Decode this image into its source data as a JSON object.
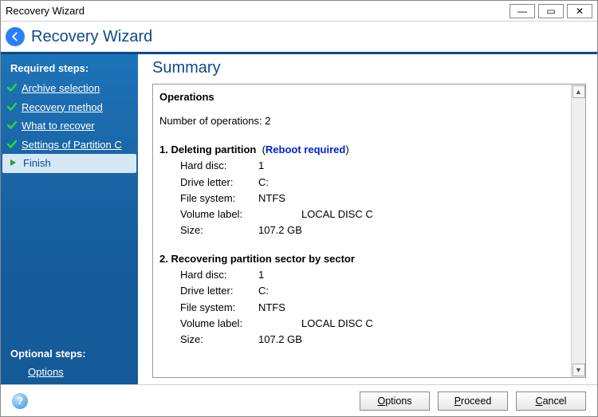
{
  "window": {
    "title": "Recovery Wizard"
  },
  "header": {
    "title": "Recovery Wizard"
  },
  "sidebar": {
    "required_heading": "Required steps:",
    "steps": [
      {
        "label": "Archive selection",
        "done": true,
        "active": false
      },
      {
        "label": "Recovery method",
        "done": true,
        "active": false
      },
      {
        "label": "What to recover",
        "done": true,
        "active": false
      },
      {
        "label": "Settings of Partition C",
        "done": true,
        "active": false
      },
      {
        "label": "Finish",
        "done": false,
        "active": true
      }
    ],
    "optional_heading": "Optional steps:",
    "optional": [
      {
        "label": "Options"
      }
    ]
  },
  "main": {
    "title": "Summary",
    "operations_heading": "Operations",
    "count_label": "Number of operations:",
    "count_value": "2",
    "ops": [
      {
        "title_prefix": "1. Deleting partition",
        "note": "Reboot required",
        "rows": [
          {
            "key": "Hard disc:",
            "val": "1"
          },
          {
            "key": "Drive letter:",
            "val": "C:"
          },
          {
            "key": "File system:",
            "val": "NTFS"
          },
          {
            "key": "Volume label:",
            "val": "LOCAL DISC C",
            "wide": true
          },
          {
            "key": "Size:",
            "val": "107.2 GB"
          }
        ]
      },
      {
        "title_prefix": "2. Recovering partition sector by sector",
        "note": "",
        "rows": [
          {
            "key": "Hard disc:",
            "val": "1"
          },
          {
            "key": "Drive letter:",
            "val": "C:"
          },
          {
            "key": "File system:",
            "val": "NTFS"
          },
          {
            "key": "Volume label:",
            "val": "LOCAL DISC C",
            "wide": true
          },
          {
            "key": "Size:",
            "val": "107.2 GB"
          }
        ]
      }
    ]
  },
  "footer": {
    "options_label": "Options",
    "proceed_label": "Proceed",
    "cancel_label": "Cancel"
  }
}
